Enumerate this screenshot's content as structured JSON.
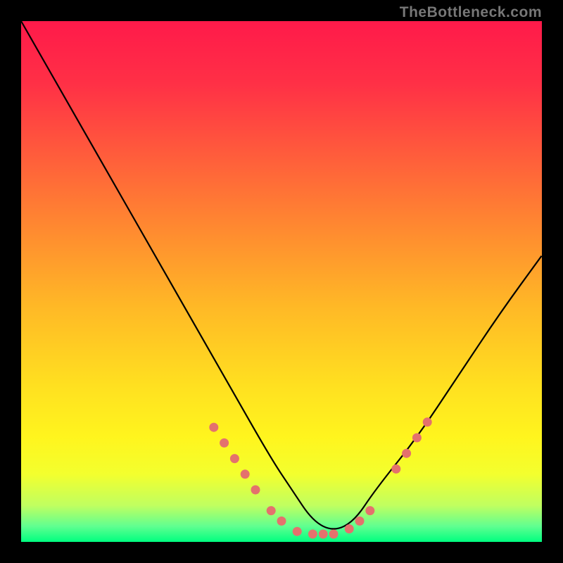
{
  "watermark": "TheBottleneck.com",
  "chart_data": {
    "type": "line",
    "title": "",
    "xlabel": "",
    "ylabel": "",
    "xlim": [
      0,
      100
    ],
    "ylim": [
      0,
      100
    ],
    "grid": false,
    "legend": false,
    "series": [
      {
        "name": "bottleneck-curve",
        "x": [
          0,
          8,
          16,
          24,
          32,
          40,
          48,
          52,
          56,
          60,
          64,
          68,
          76,
          84,
          92,
          100
        ],
        "values": [
          100,
          86,
          72,
          58,
          44,
          30,
          16,
          10,
          4,
          2,
          4,
          10,
          20,
          32,
          44,
          55
        ],
        "color": "#000000"
      }
    ],
    "markers": {
      "name": "highlight-dots",
      "color": "#e4716d",
      "points": [
        {
          "x": 37,
          "y": 22
        },
        {
          "x": 39,
          "y": 19
        },
        {
          "x": 41,
          "y": 16
        },
        {
          "x": 43,
          "y": 13
        },
        {
          "x": 45,
          "y": 10
        },
        {
          "x": 48,
          "y": 6
        },
        {
          "x": 50,
          "y": 4
        },
        {
          "x": 53,
          "y": 2
        },
        {
          "x": 56,
          "y": 1.5
        },
        {
          "x": 58,
          "y": 1.5
        },
        {
          "x": 60,
          "y": 1.5
        },
        {
          "x": 63,
          "y": 2.5
        },
        {
          "x": 65,
          "y": 4
        },
        {
          "x": 67,
          "y": 6
        },
        {
          "x": 72,
          "y": 14
        },
        {
          "x": 74,
          "y": 17
        },
        {
          "x": 76,
          "y": 20
        },
        {
          "x": 78,
          "y": 23
        }
      ]
    },
    "background_gradient": {
      "type": "vertical",
      "stops": [
        {
          "offset": 0.0,
          "color": "#ff1a4a"
        },
        {
          "offset": 0.12,
          "color": "#ff3046"
        },
        {
          "offset": 0.25,
          "color": "#ff5a3c"
        },
        {
          "offset": 0.4,
          "color": "#ff8a30"
        },
        {
          "offset": 0.55,
          "color": "#ffb926"
        },
        {
          "offset": 0.7,
          "color": "#ffe020"
        },
        {
          "offset": 0.8,
          "color": "#fff51e"
        },
        {
          "offset": 0.87,
          "color": "#f3ff2e"
        },
        {
          "offset": 0.93,
          "color": "#c0ff60"
        },
        {
          "offset": 0.97,
          "color": "#60ff90"
        },
        {
          "offset": 1.0,
          "color": "#00ff80"
        }
      ]
    }
  }
}
